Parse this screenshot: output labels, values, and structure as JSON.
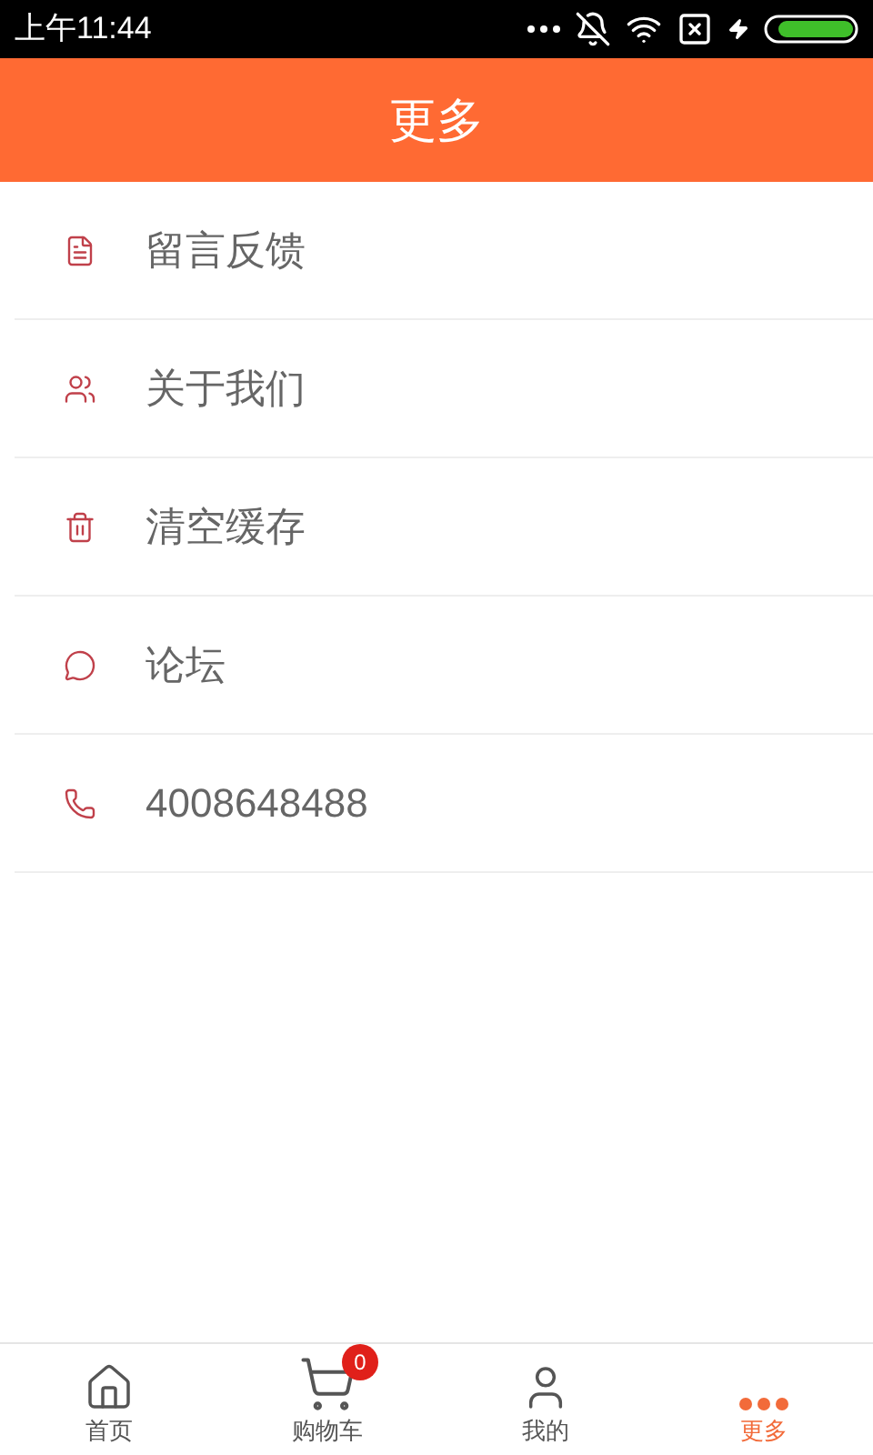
{
  "status_bar": {
    "time": "上午11:44"
  },
  "header": {
    "title": "更多"
  },
  "menu": [
    {
      "kind": "feedback",
      "label": "留言反馈"
    },
    {
      "kind": "about",
      "label": "关于我们"
    },
    {
      "kind": "clear",
      "label": "清空缓存"
    },
    {
      "kind": "forum",
      "label": "论坛"
    },
    {
      "kind": "phone",
      "label": "4008648488"
    }
  ],
  "tabs": [
    {
      "kind": "home",
      "label": "首页",
      "selected": false
    },
    {
      "kind": "cart",
      "label": "购物车",
      "selected": false,
      "badge": "0"
    },
    {
      "kind": "profile",
      "label": "我的",
      "selected": false
    },
    {
      "kind": "more",
      "label": "更多",
      "selected": true
    }
  ]
}
